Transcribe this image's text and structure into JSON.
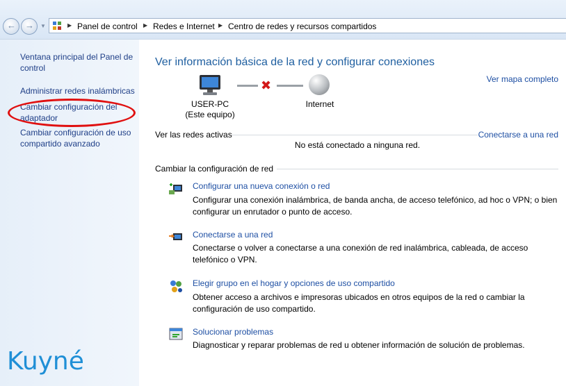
{
  "address_bar": {
    "breadcrumbs": [
      "Panel de control",
      "Redes e Internet",
      "Centro de redes y recursos compartidos"
    ]
  },
  "sidebar": {
    "items": [
      {
        "label": "Ventana principal del Panel de control"
      },
      {
        "label": "Administrar redes inalámbricas"
      },
      {
        "label": "Cambiar configuración del adaptador"
      },
      {
        "label": "Cambiar configuración de uso compartido avanzado"
      }
    ],
    "highlighted_item": "Cambiar configuración del adaptador"
  },
  "watermark": "Kuyné",
  "main": {
    "title": "Ver información básica de la red y configurar conexiones",
    "map_link": "Ver mapa completo",
    "network_map": {
      "computer_name": "USER-PC",
      "computer_note": "(Este equipo)",
      "internet_label": "Internet",
      "connection_status_icon": "red-x-disconnected-icon"
    },
    "active_networks": {
      "heading": "Ver las redes activas",
      "connect_link": "Conectarse a una red",
      "status_text": "No está conectado a ninguna red."
    },
    "change_settings": {
      "heading": "Cambiar la configuración de red",
      "tasks": [
        {
          "icon": "new-connection-icon",
          "link": "Configurar una nueva conexión o red",
          "description": "Configurar una conexión inalámbrica, de banda ancha, de acceso telefónico, ad hoc o VPN; o bien configurar un enrutador o punto de acceso."
        },
        {
          "icon": "connect-network-icon",
          "link": "Conectarse a una red",
          "description": "Conectarse o volver a conectarse a una conexión de red inalámbrica, cableada, de acceso telefónico o VPN."
        },
        {
          "icon": "homegroup-icon",
          "link": "Elegir grupo en el hogar y opciones de uso compartido",
          "description": "Obtener acceso a archivos e impresoras ubicados en otros equipos de la red o cambiar la configuración de uso compartido."
        },
        {
          "icon": "troubleshoot-icon",
          "link": "Solucionar problemas",
          "description": "Diagnosticar y reparar problemas de red u obtener información de solución de problemas."
        }
      ]
    }
  },
  "colors": {
    "link": "#1e4fa3",
    "title": "#1f5fa0",
    "highlight_circle": "#e01010",
    "watermark": "#1f8fd6"
  }
}
